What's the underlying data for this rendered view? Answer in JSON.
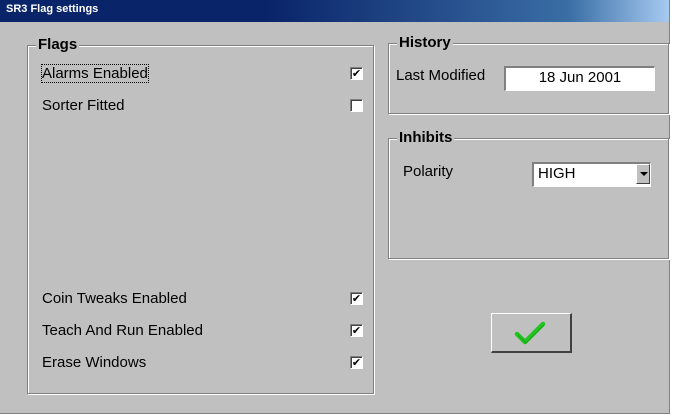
{
  "window": {
    "title": "SR3 Flag settings"
  },
  "flags": {
    "label": "Flags",
    "items": [
      {
        "label": "Alarms Enabled",
        "checked": true
      },
      {
        "label": "Sorter Fitted",
        "checked": false
      },
      {
        "label": "Coin Tweaks Enabled",
        "checked": true
      },
      {
        "label": "Teach And Run Enabled",
        "checked": true
      },
      {
        "label": "Erase Windows",
        "checked": true
      }
    ]
  },
  "history": {
    "label": "History",
    "last_modified_label": "Last Modified",
    "last_modified_value": "18 Jun 2001"
  },
  "inhibits": {
    "label": "Inhibits",
    "polarity_label": "Polarity",
    "polarity_value": "HIGH"
  },
  "ok_button": {
    "icon": "checkmark-icon",
    "color": "#22c422"
  }
}
